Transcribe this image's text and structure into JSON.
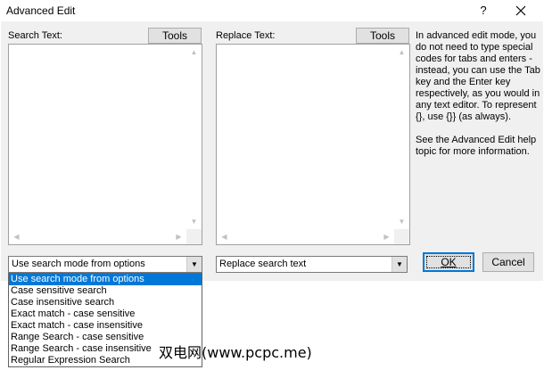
{
  "window": {
    "title": "Advanced Edit",
    "help_symbol": "?"
  },
  "search": {
    "label": "Search Text:",
    "tools_label": "Tools"
  },
  "replace": {
    "label": "Replace Text:",
    "tools_label": "Tools"
  },
  "info": {
    "paragraph1": "In advanced edit mode, you do not need to type special codes for tabs and enters - instead, you can use the Tab key and the Enter key respectively, as you would in any text editor. To represent {}, use {}} (as always).",
    "paragraph2": "See the Advanced Edit help topic for more information."
  },
  "search_mode": {
    "selected": "Use search mode from options",
    "options": [
      "Use search mode from options",
      "Case sensitive search",
      "Case insensitive search",
      "Exact match - case sensitive",
      "Exact match - case insensitive",
      "Range Search - case sensitive",
      "Range Search - case insensitive",
      "Regular Expression Search"
    ]
  },
  "replace_mode": {
    "selected": "Replace search text"
  },
  "buttons": {
    "ok": "OK",
    "cancel": "Cancel"
  },
  "watermark": "双电网(www.pcpc.me)",
  "icons": {
    "close": "close-icon",
    "dropdown": "chevron-down-icon"
  }
}
